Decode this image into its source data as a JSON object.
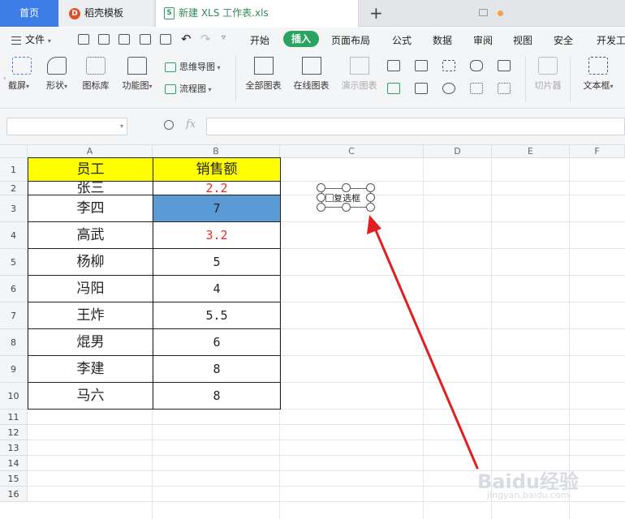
{
  "tabs": {
    "home": "首页",
    "template": "稻壳模板",
    "file": "新建 XLS 工作表.xls",
    "add": "+"
  },
  "menu": {
    "file": "文件",
    "items": [
      "开始",
      "插入",
      "页面布局",
      "公式",
      "数据",
      "审阅",
      "视图",
      "安全",
      "开发工"
    ]
  },
  "ribbon": {
    "screenshot": "截屏",
    "shape": "形状",
    "icon_library": "图标库",
    "function_chart": "功能图",
    "mindmap": "思维导图",
    "flowchart": "流程图",
    "all_charts": "全部图表",
    "online_charts": "在线图表",
    "demo_chart": "演示图表",
    "slicer": "切片器",
    "textbox": "文本框"
  },
  "formula_bar": {
    "fx": "fx",
    "name_box": "",
    "formula": ""
  },
  "sheet": {
    "columns": [
      "A",
      "B",
      "C",
      "D",
      "E",
      "F"
    ],
    "rows": [
      "1",
      "2",
      "3",
      "4",
      "5",
      "6",
      "7",
      "8",
      "9",
      "10",
      "11",
      "12",
      "13",
      "14",
      "15",
      "16"
    ],
    "headers": [
      "员工",
      "销售额"
    ],
    "data": [
      [
        "张三",
        "2.2"
      ],
      [
        "李四",
        "7"
      ],
      [
        "高武",
        "3.2"
      ],
      [
        "杨柳",
        "5"
      ],
      [
        "冯阳",
        "4"
      ],
      [
        "王炸",
        "5.5"
      ],
      [
        "焜男",
        "6"
      ],
      [
        "李建",
        "8"
      ],
      [
        "马六",
        "8"
      ]
    ]
  },
  "checkbox": {
    "label": "复选框"
  },
  "watermark": {
    "brand": "Baidu经验",
    "url": "jingyan.baidu.com"
  },
  "colors": {
    "accent_blue": "#3d7de8",
    "insert_green": "#2aa360",
    "header_yellow": "#ffff00",
    "selected_blue": "#5b9bd5",
    "red_text": "#e0301e",
    "arrow_red": "#e02020"
  }
}
